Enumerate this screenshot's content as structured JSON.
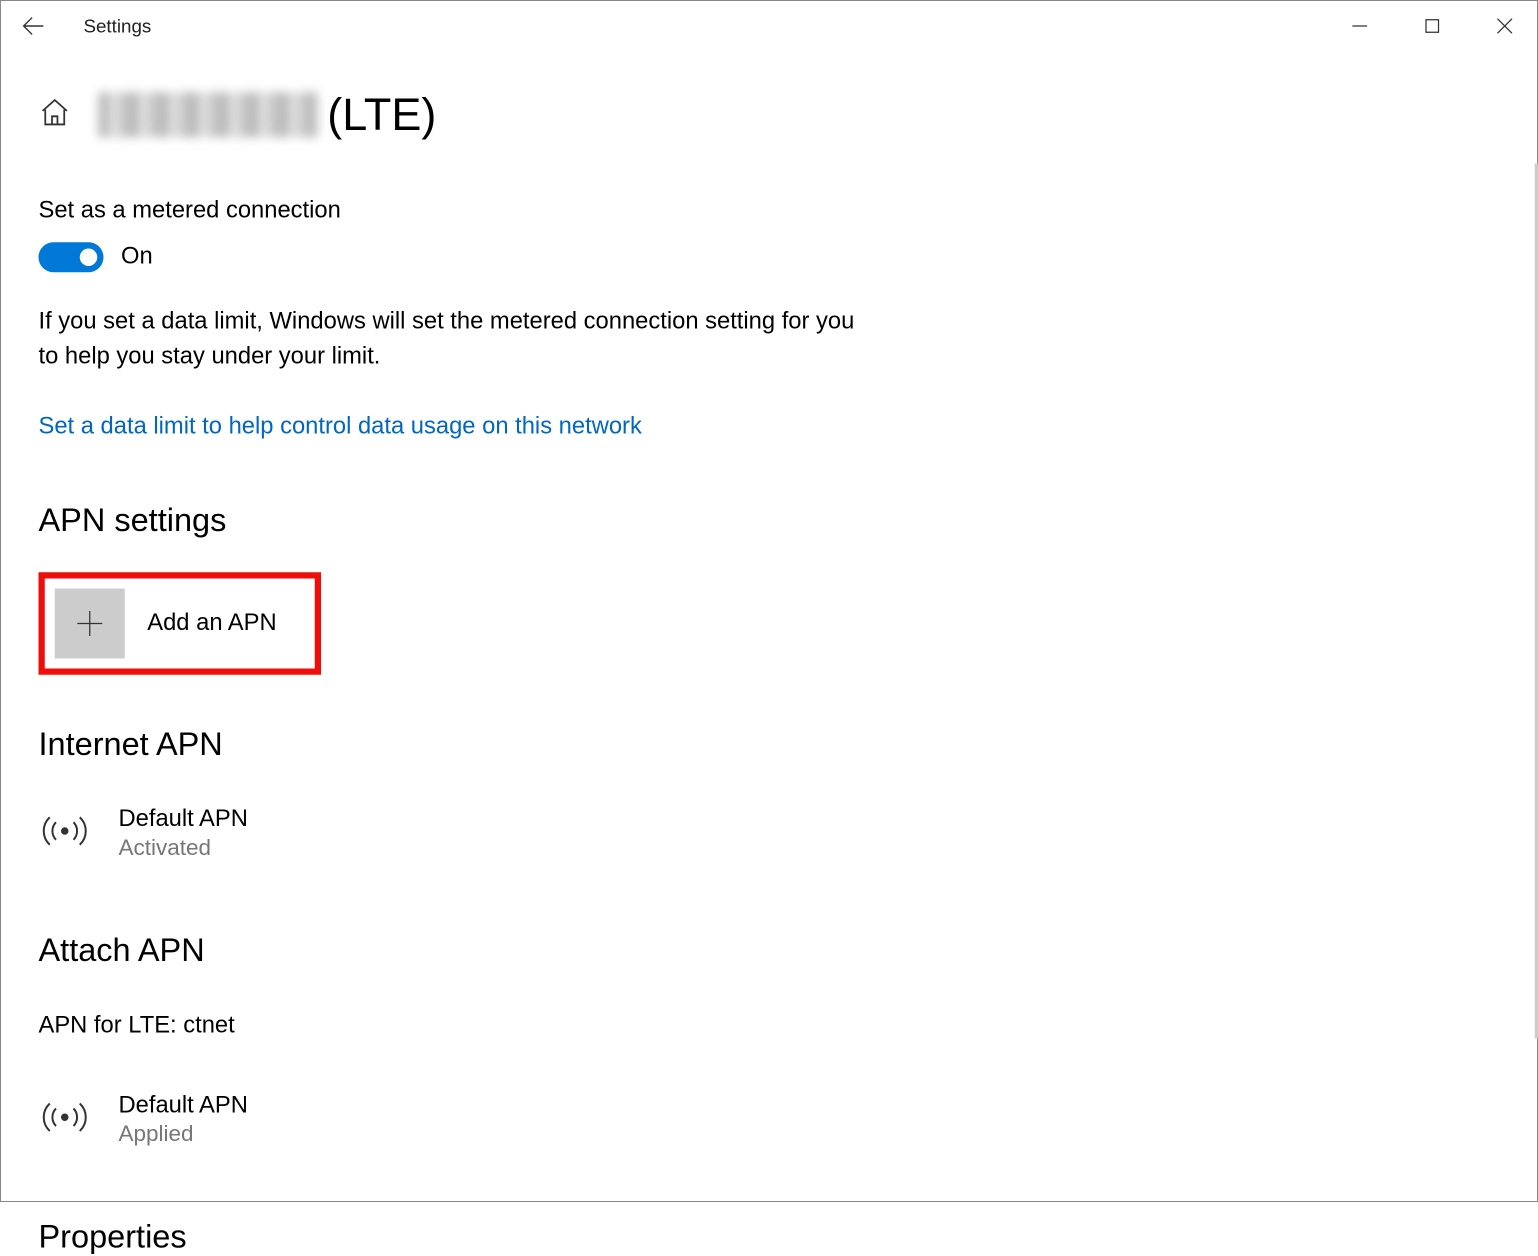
{
  "window": {
    "title": "Settings"
  },
  "page": {
    "title_suffix": "(LTE)"
  },
  "metered": {
    "label": "Set as a metered connection",
    "state": "On",
    "description": "If you set a data limit, Windows will set the metered connection setting for you to help you stay under your limit.",
    "link": "Set a data limit to help control data usage on this network"
  },
  "apn": {
    "section_title": "APN settings",
    "add_label": "Add an APN",
    "internet_title": "Internet APN",
    "internet_item": {
      "name": "Default APN",
      "status": "Activated"
    },
    "attach_title": "Attach APN",
    "attach_label": "APN for LTE: ctnet",
    "attach_item": {
      "name": "Default APN",
      "status": "Applied"
    }
  },
  "properties": {
    "title": "Properties"
  }
}
